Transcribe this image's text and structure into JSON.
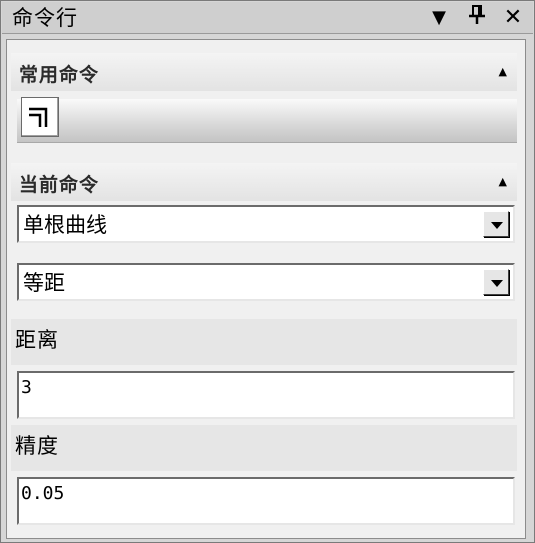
{
  "window": {
    "title": "命令行",
    "menu_icon": "dropdown-triangle-icon",
    "pin_icon": "pin-icon",
    "close_icon": "close-icon"
  },
  "common_commands": {
    "title": "常用命令",
    "collapse_icon": "collapse-up-icon",
    "tools": [
      {
        "icon": "equidistant-curve-icon"
      }
    ]
  },
  "current_command": {
    "title": "当前命令",
    "collapse_icon": "collapse-up-icon",
    "curve_type": {
      "value": "单根曲线"
    },
    "mode": {
      "value": "等距"
    },
    "distance": {
      "label": "距离",
      "value": "3"
    },
    "precision": {
      "label": "精度",
      "value": "0.05"
    }
  }
}
